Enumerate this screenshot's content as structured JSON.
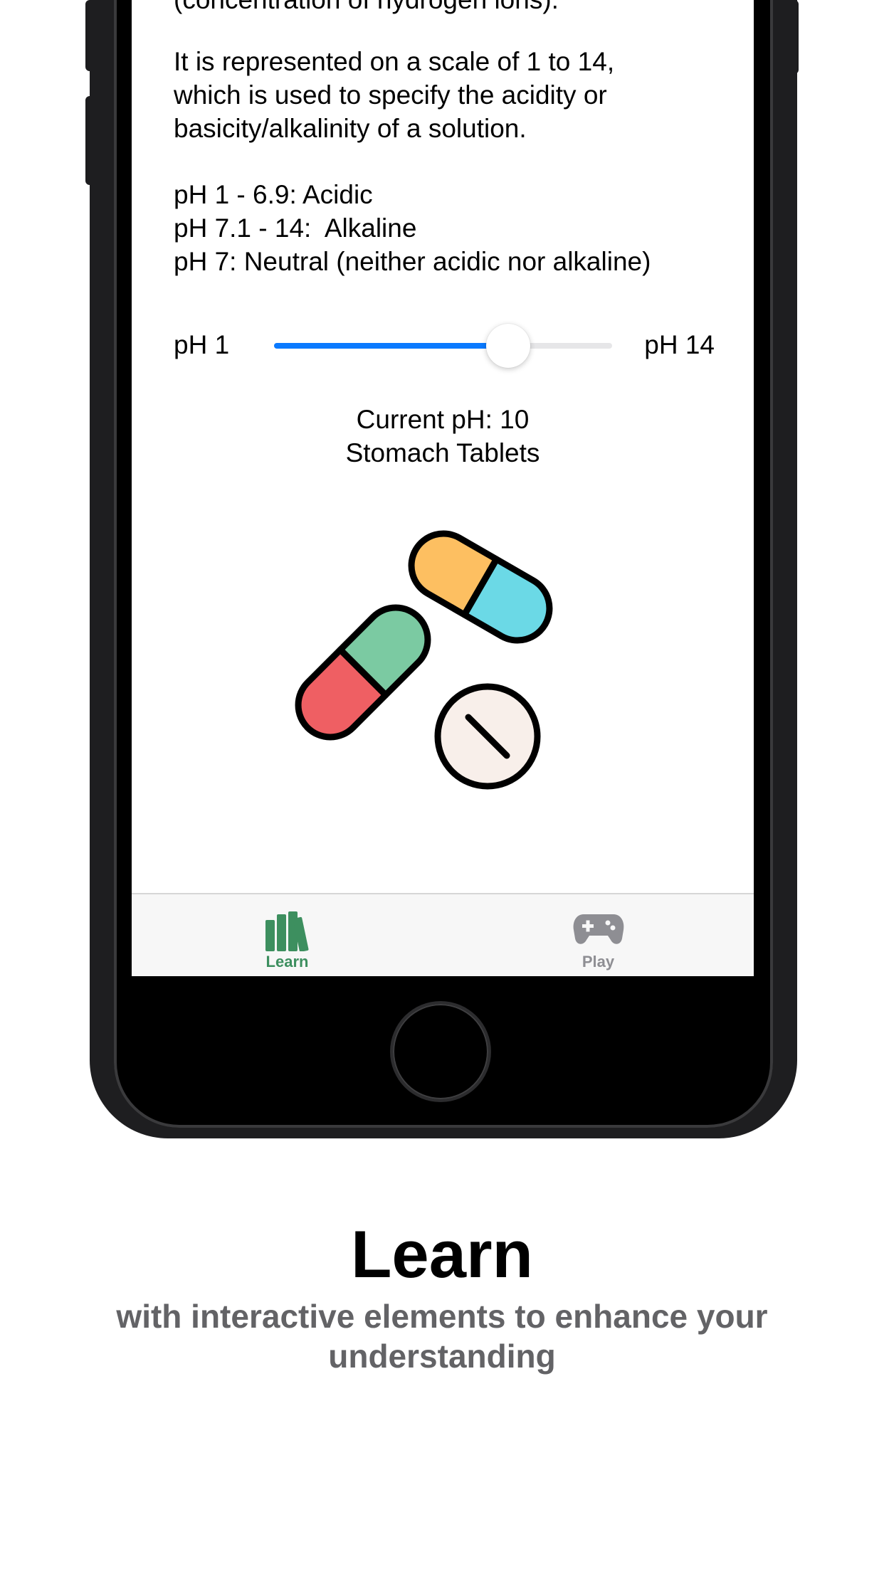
{
  "screen": {
    "intro_partial": "(concentration of hydrogen ions).",
    "scale_paragraph": "It is represented on a scale of 1 to 14,\nwhich is used to specify the acidity or\nbasicity/alkalinity of a solution.",
    "ranges": [
      "pH 1 - 6.9: Acidic",
      "pH 7.1 - 14:  Alkaline",
      "pH 7: Neutral (neither acidic nor alkaline)"
    ],
    "slider": {
      "min_label": "pH 1",
      "max_label": "pH 14",
      "min": 1,
      "max": 14,
      "value": 10
    },
    "current_ph": "Current pH: 10",
    "example_name": "Stomach Tablets",
    "illustration": "pills-icon",
    "colors": {
      "slider_fill": "#0a7aff",
      "tab_active": "#3d8f5f",
      "tab_inactive": "#8e8e93"
    }
  },
  "tabbar": {
    "tabs": [
      {
        "label": "Learn",
        "icon": "books-icon",
        "active": true
      },
      {
        "label": "Play",
        "icon": "gamepad-icon",
        "active": false
      }
    ]
  },
  "caption": {
    "title": "Learn",
    "subtitle": "with interactive elements to enhance your understanding"
  }
}
